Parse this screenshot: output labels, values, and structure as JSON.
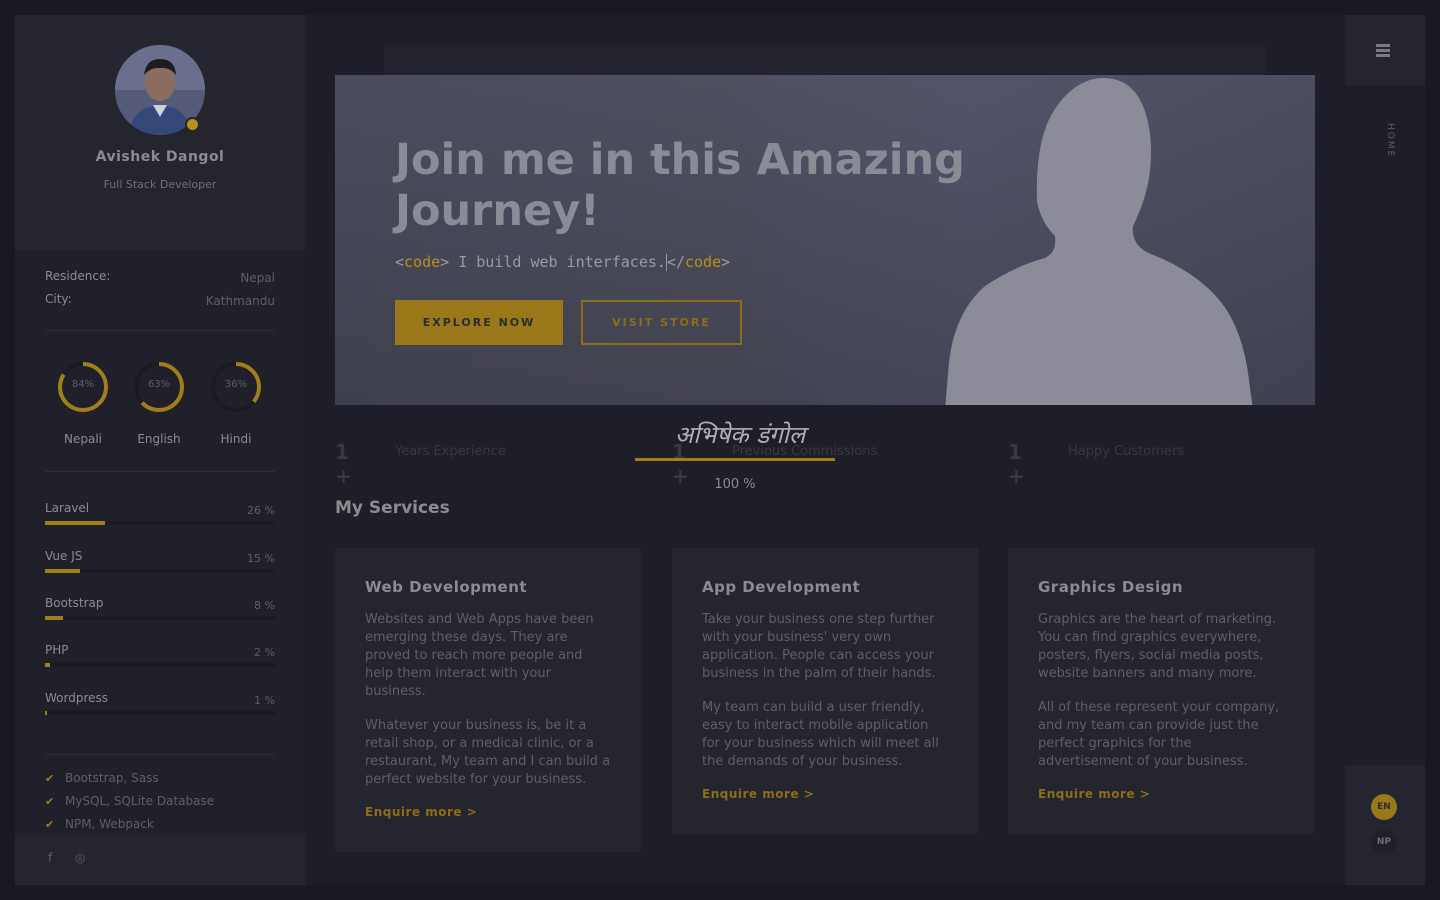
{
  "profile": {
    "name": "Avishek Dangol",
    "role": "Full Stack Developer"
  },
  "info": [
    {
      "key": "Residence:",
      "value": "Nepal"
    },
    {
      "key": "City:",
      "value": "Kathmandu"
    }
  ],
  "languages": [
    {
      "name": "Nepali",
      "percent_label": "84%",
      "percent": 84
    },
    {
      "name": "English",
      "percent_label": "63%",
      "percent": 63
    },
    {
      "name": "Hindi",
      "percent_label": "36%",
      "percent": 36
    }
  ],
  "skills": [
    {
      "name": "Laravel",
      "percent_label": "26 %",
      "percent": 26
    },
    {
      "name": "Vue JS",
      "percent_label": "15 %",
      "percent": 15
    },
    {
      "name": "Bootstrap",
      "percent_label": "8 %",
      "percent": 8
    },
    {
      "name": "PHP",
      "percent_label": "2 %",
      "percent": 2
    },
    {
      "name": "Wordpress",
      "percent_label": "1 %",
      "percent": 1
    }
  ],
  "tools": [
    "Bootstrap, Sass",
    "MySQL, SQLite Database",
    "NPM, Webpack"
  ],
  "social": {
    "facebook_icon": "f",
    "instagram_icon": "◎"
  },
  "hero": {
    "title": "Join me in this Amazing Journey!",
    "code_open_lt": "<",
    "code_tag": "code",
    "code_open_gt": ">",
    "code_text": " I build web interfaces.",
    "code_close_lt": "</",
    "code_close_gt": ">",
    "explore_label": "EXPLORE NOW",
    "store_label": "VISIT STORE"
  },
  "loader": {
    "name_devanagari": "अभिषेक डंगोल",
    "progress_label": "100 %",
    "progress": 100
  },
  "counters": [
    {
      "number": "1",
      "plus": "+",
      "label": "Years Experience"
    },
    {
      "number": "1",
      "plus": "+",
      "label": "Previous Commissions"
    },
    {
      "number": "1",
      "plus": "+",
      "label": "Happy Customers"
    }
  ],
  "services": {
    "title": "My Services",
    "cards": [
      {
        "title": "Web Development",
        "paragraphs": [
          "Websites and Web Apps have been emerging these days. They are proved to reach more people and help them interact with your business.",
          "Whatever your business is, be it a retail shop, or a medical clinic, or a restaurant, My team and I can build a perfect website for your business."
        ],
        "more": "Enquire more >"
      },
      {
        "title": "App Development",
        "paragraphs": [
          "Take your business one step further with your business' very own application. People can access your business in the palm of their hands.",
          "My team can build a user friendly, easy to interact mobile application for your business which will meet all the demands of your business."
        ],
        "more": "Enquire more >"
      },
      {
        "title": "Graphics Design",
        "paragraphs": [
          "Graphics are the heart of marketing. You can find graphics everywhere, posters, flyers, social media posts, website banners and many more.",
          "All of these represent your company, and my team can provide just the perfect graphics for the advertisement of your business."
        ],
        "more": "Enquire more >"
      }
    ]
  },
  "nav": {
    "home_label": "HOME",
    "lang_en": "EN",
    "lang_np": "NP"
  },
  "colors": {
    "accent": "#b8901d",
    "background": "#1e1e28",
    "card": "#252530"
  }
}
